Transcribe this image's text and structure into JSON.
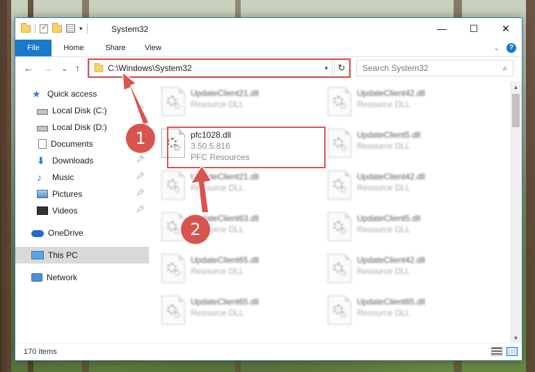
{
  "window": {
    "title": "System32",
    "controls": {
      "minimize": "—",
      "maximize": "☐",
      "close": "✕"
    }
  },
  "ribbon": {
    "tabs": [
      "File",
      "Home",
      "Share",
      "View"
    ],
    "help": "?"
  },
  "navigation": {
    "back": "←",
    "forward": "→",
    "recent": "⌄",
    "up": "↑",
    "address": "C:\\Windows\\System32",
    "refresh": "↻",
    "search_placeholder": "Search System32"
  },
  "sidebar": {
    "items": [
      {
        "label": "Quick access",
        "icon": "quick-access-star-icon",
        "pinned": false
      },
      {
        "label": "Local Disk (C:)",
        "icon": "drive-icon",
        "pinned": true
      },
      {
        "label": "Local Disk (D:)",
        "icon": "drive-icon",
        "pinned": false
      },
      {
        "label": "Documents",
        "icon": "documents-icon",
        "pinned": true
      },
      {
        "label": "Downloads",
        "icon": "downloads-icon",
        "pinned": true
      },
      {
        "label": "Music",
        "icon": "music-icon",
        "pinned": true
      },
      {
        "label": "Pictures",
        "icon": "pictures-icon",
        "pinned": true
      },
      {
        "label": "Videos",
        "icon": "videos-icon",
        "pinned": true
      },
      {
        "label": "OneDrive",
        "icon": "onedrive-icon",
        "pinned": false
      },
      {
        "label": "This PC",
        "icon": "this-pc-icon",
        "pinned": false,
        "selected": true
      },
      {
        "label": "Network",
        "icon": "network-icon",
        "pinned": false
      }
    ]
  },
  "files": [
    {
      "name": "UpdateClient21.dll",
      "detail": "Resource DLL",
      "blurred": true
    },
    {
      "name": "UpdateClient42.dll",
      "detail": "Resource DLL",
      "blurred": true
    },
    {
      "name": "pfc1028.dll",
      "version": "3.50.5.816",
      "detail": "PFC Resources",
      "blurred": false
    },
    {
      "name": "UpdateClient5.dll",
      "detail": "Resource DLL",
      "blurred": true
    },
    {
      "name": "UpdateClient21.dll",
      "detail": "Resource DLL",
      "blurred": true
    },
    {
      "name": "UpdateClient42.dll",
      "detail": "Resource DLL",
      "blurred": true
    },
    {
      "name": "UpdateClient63.dll",
      "detail": "Resource DLL",
      "blurred": true
    },
    {
      "name": "UpdateClient5.dll",
      "detail": "Resource DLL",
      "blurred": true
    },
    {
      "name": "UpdateClient65.dll",
      "detail": "Resource DLL",
      "blurred": true
    },
    {
      "name": "UpdateClient42.dll",
      "detail": "Resource DLL",
      "blurred": true
    },
    {
      "name": "UpdateClient65.dll",
      "detail": "Resource DLL",
      "blurred": true
    },
    {
      "name": "UpdateClient65.dll",
      "detail": "Resource DLL",
      "blurred": true
    }
  ],
  "status": {
    "item_count": "170 items"
  },
  "callouts": {
    "step1": "1",
    "step2": "2",
    "color": "#d9534f"
  },
  "colors": {
    "accent": "#1979ca",
    "highlight": "#d9534f"
  }
}
